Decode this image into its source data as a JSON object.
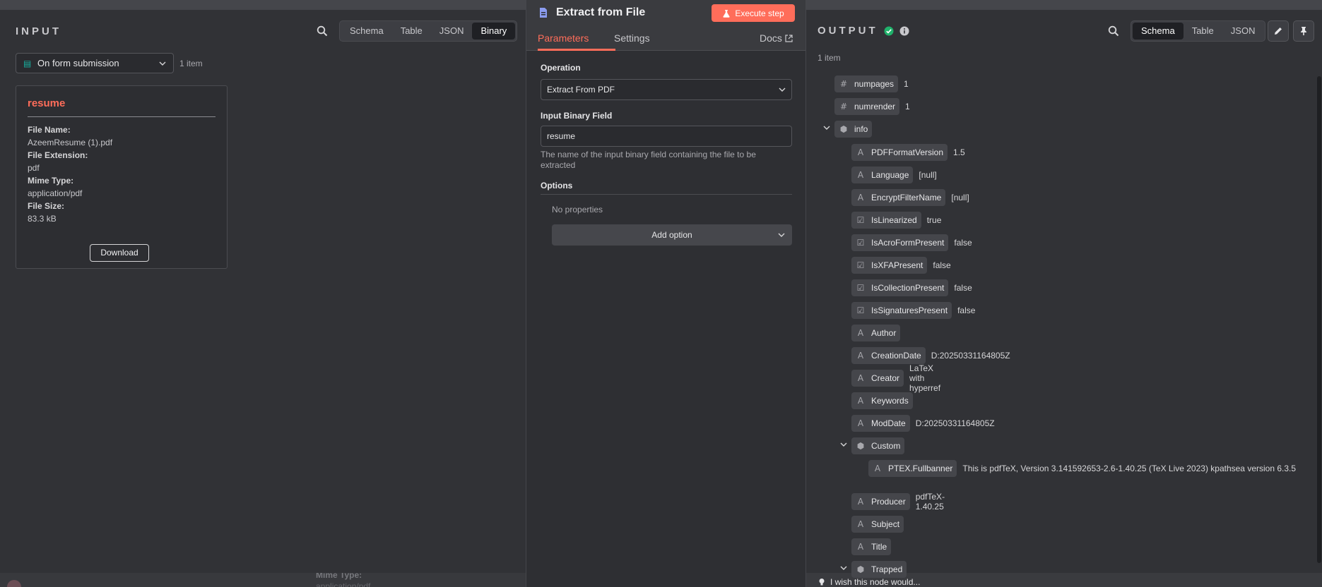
{
  "input": {
    "title": "INPUT",
    "view_tabs": [
      "Schema",
      "Table",
      "JSON",
      "Binary"
    ],
    "active_tab": "Binary",
    "source_node": "On form submission",
    "item_count": "1 item",
    "binary": {
      "name": "resume",
      "file_name_label": "File Name:",
      "file_name": "AzeemResume (1).pdf",
      "file_extension_label": "File Extension:",
      "file_extension": "pdf",
      "mime_type_label": "Mime Type:",
      "mime_type": "application/pdf",
      "file_size_label": "File Size:",
      "file_size": "83.3 kB",
      "download_label": "Download"
    }
  },
  "background": {
    "peek_label": "Mime Type:",
    "peek_value": "application/pdf"
  },
  "node": {
    "title": "Extract from File",
    "execute_label": "Execute step",
    "tabs": [
      "Parameters",
      "Settings"
    ],
    "docs_label": "Docs",
    "operation_label": "Operation",
    "operation_value": "Extract From PDF",
    "binary_field_label": "Input Binary Field",
    "binary_field_value": "resume",
    "binary_field_hint": "The name of the input binary field containing the file to be extracted",
    "options_label": "Options",
    "no_properties": "No properties",
    "add_option_label": "Add option"
  },
  "output": {
    "title": "OUTPUT",
    "view_tabs": [
      "Schema",
      "Table",
      "JSON"
    ],
    "active_tab": "Schema",
    "item_count": "1 item",
    "rows": [
      {
        "key": "numpages",
        "type": "#",
        "value": "1"
      },
      {
        "key": "numrender",
        "type": "#",
        "value": "1"
      },
      {
        "key": "info",
        "type": "obj",
        "value": ""
      },
      {
        "key": "PDFFormatVersion",
        "type": "A",
        "value": "1.5"
      },
      {
        "key": "Language",
        "type": "A",
        "value": "[null]"
      },
      {
        "key": "EncryptFilterName",
        "type": "A",
        "value": "[null]"
      },
      {
        "key": "IsLinearized",
        "type": "bool",
        "value": "true"
      },
      {
        "key": "IsAcroFormPresent",
        "type": "bool",
        "value": "false"
      },
      {
        "key": "IsXFAPresent",
        "type": "bool",
        "value": "false"
      },
      {
        "key": "IsCollectionPresent",
        "type": "bool",
        "value": "false"
      },
      {
        "key": "IsSignaturesPresent",
        "type": "bool",
        "value": "false"
      },
      {
        "key": "Author",
        "type": "A",
        "value": ""
      },
      {
        "key": "CreationDate",
        "type": "A",
        "value": "D:20250331164805Z"
      },
      {
        "key": "Creator",
        "type": "A",
        "value": "LaTeX with hyperref"
      },
      {
        "key": "Keywords",
        "type": "A",
        "value": ""
      },
      {
        "key": "ModDate",
        "type": "A",
        "value": "D:20250331164805Z"
      },
      {
        "key": "Custom",
        "type": "obj",
        "value": ""
      },
      {
        "key": "PTEX.Fullbanner",
        "type": "A",
        "value": "This is pdfTeX, Version 3.141592653-2.6-1.40.25 (TeX Live 2023) kpathsea version 6.3.5"
      },
      {
        "key": "Producer",
        "type": "A",
        "value": "pdfTeX-1.40.25"
      },
      {
        "key": "Subject",
        "type": "A",
        "value": ""
      },
      {
        "key": "Title",
        "type": "A",
        "value": ""
      },
      {
        "key": "Trapped",
        "type": "obj",
        "value": ""
      }
    ]
  },
  "feedback_label": "I wish this node would...",
  "colors": {
    "accent": "#ff6d5a",
    "success": "#20b26b",
    "panel": "#313236"
  }
}
